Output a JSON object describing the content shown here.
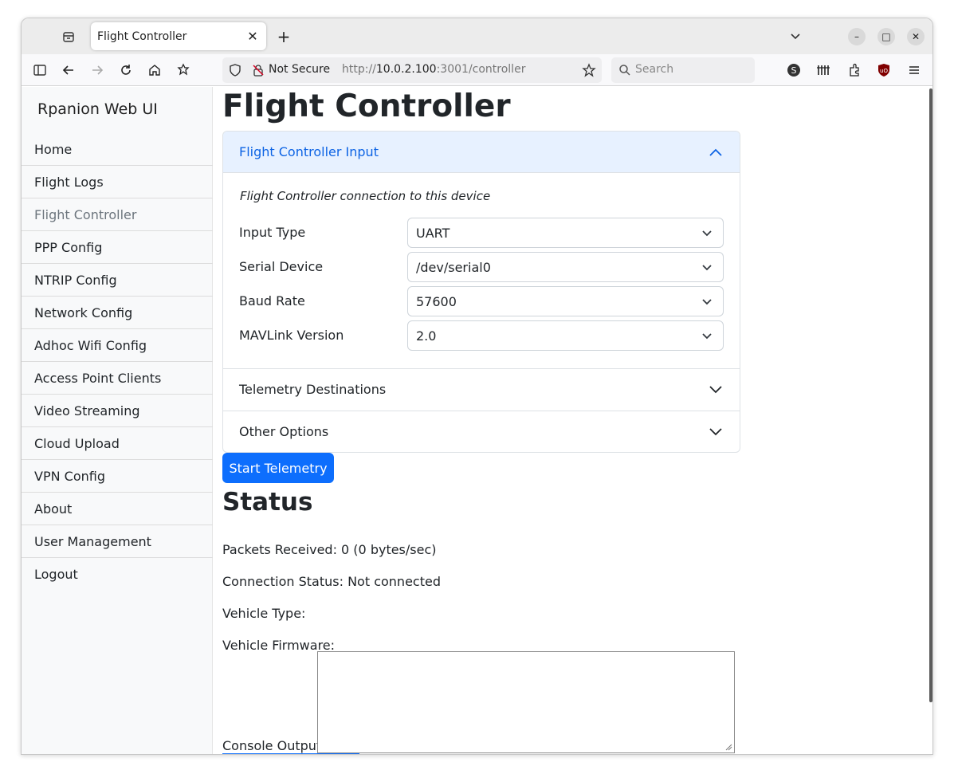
{
  "browser": {
    "tab_title": "Flight Controller",
    "url_prefix": "http://",
    "url_host": "10.0.2.100",
    "url_rest": ":3001/controller",
    "security_label": "Not Secure",
    "search_placeholder": "Search"
  },
  "sidebar": {
    "brand": "Rpanion Web UI",
    "items": [
      {
        "label": "Home"
      },
      {
        "label": "Flight Logs"
      },
      {
        "label": "Flight Controller",
        "active": true
      },
      {
        "label": "PPP Config"
      },
      {
        "label": "NTRIP Config"
      },
      {
        "label": "Network Config"
      },
      {
        "label": "Adhoc Wifi Config"
      },
      {
        "label": "Access Point Clients"
      },
      {
        "label": "Video Streaming"
      },
      {
        "label": "Cloud Upload"
      },
      {
        "label": "VPN Config"
      },
      {
        "label": "About"
      },
      {
        "label": "User Management"
      },
      {
        "label": "Logout"
      }
    ]
  },
  "main": {
    "title": "Flight Controller",
    "accordion": {
      "input_header": "Flight Controller Input",
      "description": "Flight Controller connection to this device",
      "fields": [
        {
          "label": "Input Type",
          "value": "UART"
        },
        {
          "label": "Serial Device",
          "value": "/dev/serial0"
        },
        {
          "label": "Baud Rate",
          "value": "57600"
        },
        {
          "label": "MAVLink Version",
          "value": "2.0"
        }
      ],
      "telemetry_header": "Telemetry Destinations",
      "other_header": "Other Options"
    },
    "start_button": "Start Telemetry",
    "status": {
      "heading": "Status",
      "packets": "Packets Received: 0 (0 bytes/sec)",
      "connection": "Connection Status: Not connected",
      "vehicle_type": "Vehicle Type:",
      "vehicle_firmware": "Vehicle Firmware:",
      "console_label": "Console Output:"
    }
  },
  "colors": {
    "primary": "#0d6efd",
    "accordion_open_bg": "#e7f1ff",
    "accordion_open_text": "#0c63e4",
    "sidebar_bg": "#f8f9fa",
    "active_nav_text": "#6c757d"
  }
}
